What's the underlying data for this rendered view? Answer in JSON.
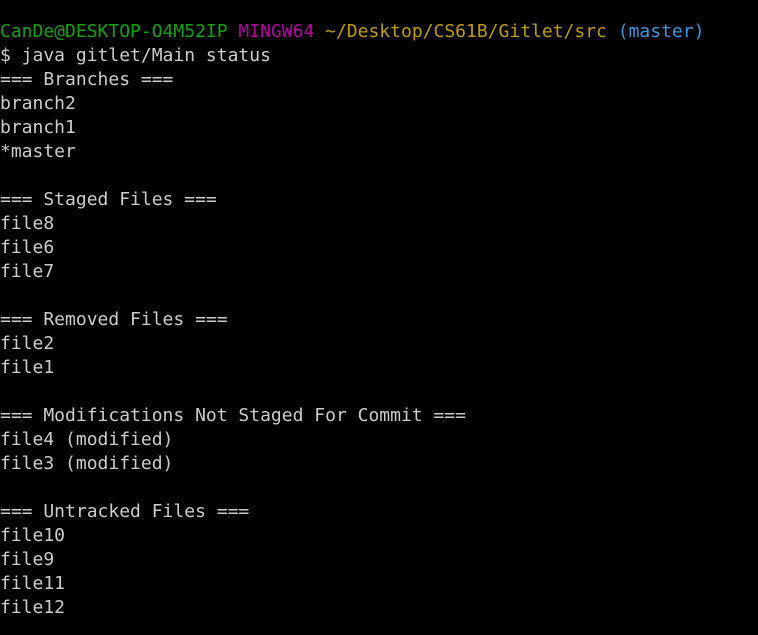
{
  "colors": {
    "background": "#000000",
    "text": "#cccccc",
    "user_host": "#13a10e",
    "mingw": "#b4009e",
    "path": "#c19c00",
    "branch": "#3a96dd"
  },
  "prompt": {
    "user_host": "CanDe@DESKTOP-O4M52IP",
    "env": "MINGW64",
    "path": "~/Desktop/CS61B/Gitlet/src",
    "branch": "(master)"
  },
  "command": "$ java gitlet/Main status",
  "sections": {
    "branches": {
      "header": "=== Branches ===",
      "items": [
        "branch2",
        "branch1",
        "*master"
      ]
    },
    "staged": {
      "header": "=== Staged Files ===",
      "items": [
        "file8",
        "file6",
        "file7"
      ]
    },
    "removed": {
      "header": "=== Removed Files ===",
      "items": [
        "file2",
        "file1"
      ]
    },
    "modifications": {
      "header": "=== Modifications Not Staged For Commit ===",
      "items": [
        "file4 (modified)",
        "file3 (modified)"
      ]
    },
    "untracked": {
      "header": "=== Untracked Files ===",
      "items": [
        "file10",
        "file9",
        "file11",
        "file12"
      ]
    }
  }
}
